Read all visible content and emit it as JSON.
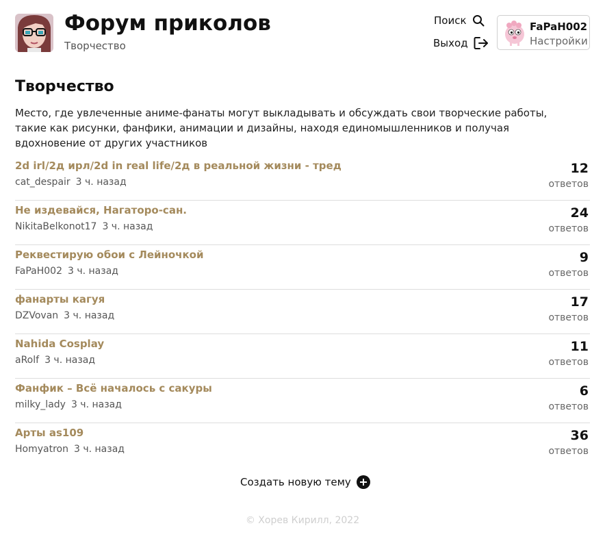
{
  "header": {
    "title": "Форум приколов",
    "subtitle": "Творчество",
    "search_label": "Поиск",
    "logout_label": "Выход",
    "user": {
      "name": "FaPaH002",
      "settings_label": "Настройки"
    }
  },
  "section": {
    "title": "Творчество",
    "description": "Место, где увлеченные аниме-фанаты могут выкладывать и обсуждать свои творческие работы, такие как рисунки, фанфики, анимации и дизайны, находя единомышленников и получая вдохновение от других участников"
  },
  "topics": [
    {
      "title": "2d irl/2д ирл/2d in real life/2д в реальной жизни - тред",
      "author": "cat_despair",
      "time": "3 ч. назад",
      "replies": "12",
      "replies_label": "ответов"
    },
    {
      "title": "Не издевайся, Нагаторо-сан.",
      "author": "NikitaBelkonot17",
      "time": "3 ч. назад",
      "replies": "24",
      "replies_label": "ответов"
    },
    {
      "title": "Реквестирую обои с Лейночкой",
      "author": "FaPaH002",
      "time": "3 ч. назад",
      "replies": "9",
      "replies_label": "ответов"
    },
    {
      "title": "фанарты кагуя",
      "author": "DZVovan",
      "time": "3 ч. назад",
      "replies": "17",
      "replies_label": "ответов"
    },
    {
      "title": "Nahida Cosplay",
      "author": "aRolf",
      "time": "3 ч. назад",
      "replies": "11",
      "replies_label": "ответов"
    },
    {
      "title": "Фанфик – Всё началось с сакуры",
      "author": "milky_lady",
      "time": "3 ч. назад",
      "replies": "6",
      "replies_label": "ответов"
    },
    {
      "title": "Арты as109",
      "author": "Homyatron",
      "time": "3 ч. назад",
      "replies": "36",
      "replies_label": "ответов"
    }
  ],
  "create_topic_label": "Создать новую тему",
  "footer": "© Хорев Кирилл, 2022",
  "colors": {
    "topic_link": "#a48a5c",
    "divider": "#dddddd",
    "footer_text": "#cfcfcf"
  },
  "icons": {
    "logo": "anime-girl-glasses-avatar",
    "search": "search-icon",
    "logout": "logout-icon",
    "user_avatar": "smeshariki-nyusha-avatar",
    "create": "plus-circle-icon"
  }
}
